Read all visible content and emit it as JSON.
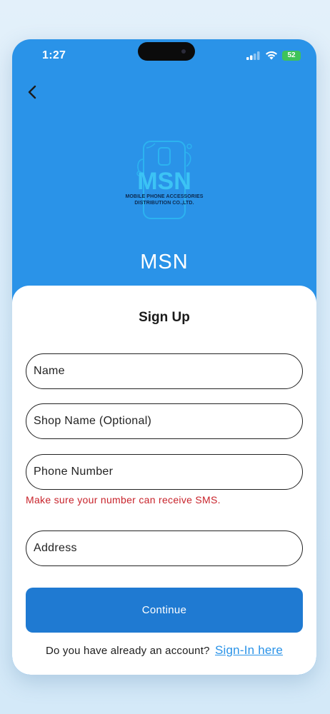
{
  "status_bar": {
    "time": "1:27",
    "battery": "52"
  },
  "header": {
    "logo_text": "MSN",
    "logo_caption_line1": "MOBILE PHONE ACCESSORIES",
    "logo_caption_line2": "DISTRIBUTION CO.,LTD.",
    "app_name": "MSN"
  },
  "form": {
    "title": "Sign Up",
    "name_placeholder": "Name",
    "shop_placeholder": "Shop Name (Optional)",
    "phone_placeholder": "Phone Number",
    "phone_hint": "Make sure your number can receive SMS.",
    "address_placeholder": "Address",
    "continue_label": "Continue"
  },
  "footer": {
    "prompt": "Do you have already an account?",
    "signin_label": "Sign-In here"
  },
  "colors": {
    "header_blue": "#2a93e8",
    "button_blue": "#1f7ad2",
    "error_red": "#c8232b",
    "battery_green": "#3ec35a"
  },
  "icons": [
    "back-arrow-icon",
    "cellular-signal-icon",
    "wifi-icon",
    "battery-icon",
    "phone-logo-icon"
  ]
}
